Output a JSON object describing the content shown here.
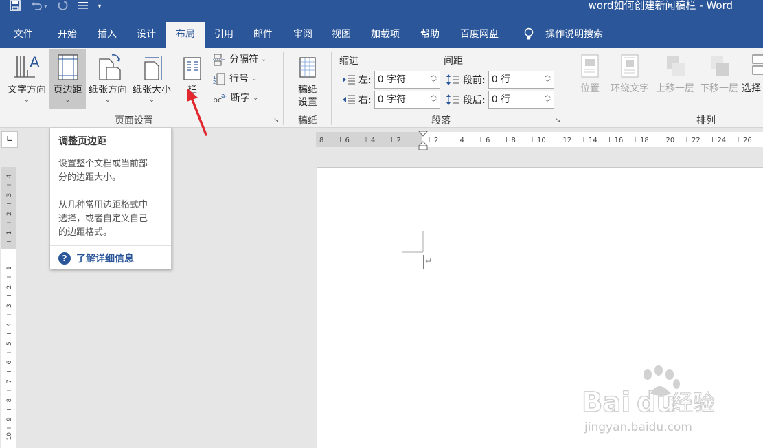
{
  "title_bar": {
    "doc_title": "word如何创建新闻稿栏  -  Word",
    "icons": [
      "save-icon",
      "undo-icon",
      "redo-icon",
      "touch-mode-icon",
      "customize-qat-icon"
    ]
  },
  "tabs": [
    "文件",
    "开始",
    "插入",
    "设计",
    "布局",
    "引用",
    "邮件",
    "审阅",
    "视图",
    "加载项",
    "帮助",
    "百度网盘"
  ],
  "active_tab": "布局",
  "tell_me": "操作说明搜索",
  "ribbon": {
    "page_setup": {
      "text_direction": "文字方向",
      "margins": "页边距",
      "orientation": "纸张方向",
      "size": "纸张大小",
      "columns": "栏",
      "breaks": "分隔符",
      "line_numbers": "行号",
      "hyphenation": "断字",
      "group_label": "页面设置"
    },
    "manuscript": {
      "button": "稿纸\n设置",
      "button_line1": "稿纸",
      "button_line2": "设置",
      "group_label": "稿纸"
    },
    "paragraph": {
      "indent_header": "缩进",
      "spacing_header": "间距",
      "left_label": "左:",
      "left_value": "0 字符",
      "right_label": "右:",
      "right_value": "0 字符",
      "before_label": "段前:",
      "before_value": "0 行",
      "after_label": "段后:",
      "after_value": "0 行",
      "group_label": "段落"
    },
    "arrange": {
      "position": "位置",
      "wrap_text": "环绕文字",
      "bring_forward": "上移一层",
      "send_backward": "下移一层",
      "selection": "选择",
      "group_label": "排列"
    }
  },
  "tooltip": {
    "title": "调整页边距",
    "desc1_line1": "设置整个文档或当前部",
    "desc1_line2": "分的边距大小。",
    "desc2_line1": "从几种常用边距格式中",
    "desc2_line2": "选择，或者自定义自己",
    "desc2_line3": "的边距格式。",
    "link": "了解详细信息"
  },
  "ruler": {
    "h_ticks": [
      "8",
      "6",
      "4",
      "2",
      "2",
      "4",
      "6",
      "8",
      "10",
      "12",
      "14",
      "16",
      "18",
      "20",
      "22",
      "24",
      "26"
    ],
    "v_ticks": [
      "4",
      "3",
      "2",
      "1",
      "1",
      "2",
      "3",
      "4",
      "5",
      "6",
      "7",
      "8",
      "9",
      "10"
    ],
    "corner_symbol": "∟"
  },
  "watermark": {
    "brand": "Bai",
    "brand2": "du",
    "brand_cn": "经验",
    "url": "jingyan.baidu.com"
  },
  "colors": {
    "title_blue": "#2b579a",
    "ribbon_bg": "#f3f3f3",
    "arrow_red": "#e0282e"
  }
}
